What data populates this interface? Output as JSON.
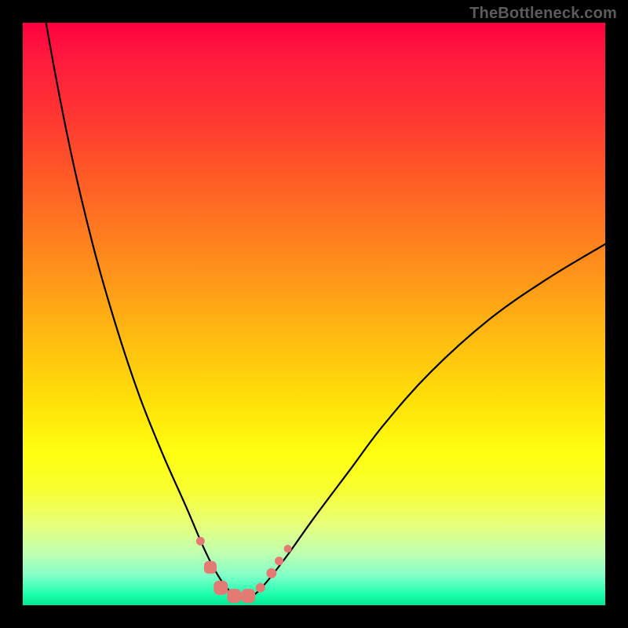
{
  "watermark": "TheBottleneck.com",
  "chart_data": {
    "type": "line",
    "title": "",
    "xlabel": "",
    "ylabel": "",
    "xlim": [
      0,
      100
    ],
    "ylim": [
      0,
      100
    ],
    "background_gradient": {
      "top": "#ff0040",
      "upper_mid": "#ff7820",
      "mid": "#ffe008",
      "lower_mid": "#ffff20",
      "bottom": "#00e890"
    },
    "series": [
      {
        "name": "main-curve",
        "color": "#000000",
        "x": [
          0,
          4,
          8,
          12,
          16,
          20,
          24,
          28,
          31,
          33,
          35,
          37,
          39,
          41,
          45,
          50,
          56,
          62,
          70,
          80,
          90,
          100
        ],
        "y": [
          125,
          100,
          79,
          62,
          48,
          36,
          26,
          17,
          10,
          6,
          3,
          1.5,
          1.5,
          3,
          8,
          15,
          23,
          31,
          40,
          49,
          56,
          62
        ]
      }
    ],
    "markers": [
      {
        "name": "marker-1",
        "shape": "circle",
        "x": 30.5,
        "y": 11,
        "size": 11,
        "color": "#e37a73"
      },
      {
        "name": "marker-2",
        "shape": "rounded-square",
        "x": 32.2,
        "y": 6.5,
        "size": 16,
        "color": "#e37a73"
      },
      {
        "name": "marker-3",
        "shape": "rounded-square",
        "x": 34.0,
        "y": 3.0,
        "size": 18,
        "color": "#e37a73"
      },
      {
        "name": "marker-4",
        "shape": "rounded-square",
        "x": 36.3,
        "y": 1.6,
        "size": 18,
        "color": "#e37a73"
      },
      {
        "name": "marker-5",
        "shape": "rounded-square",
        "x": 38.7,
        "y": 1.6,
        "size": 18,
        "color": "#e37a73"
      },
      {
        "name": "marker-6",
        "shape": "circle",
        "x": 40.8,
        "y": 3.0,
        "size": 12,
        "color": "#e37a73"
      },
      {
        "name": "marker-7",
        "shape": "circle",
        "x": 42.7,
        "y": 5.5,
        "size": 13,
        "color": "#e37a73"
      },
      {
        "name": "marker-8",
        "shape": "circle",
        "x": 44.0,
        "y": 7.6,
        "size": 11,
        "color": "#e37a73"
      },
      {
        "name": "marker-9",
        "shape": "circle",
        "x": 45.5,
        "y": 9.7,
        "size": 10,
        "color": "#e37a73"
      }
    ]
  }
}
